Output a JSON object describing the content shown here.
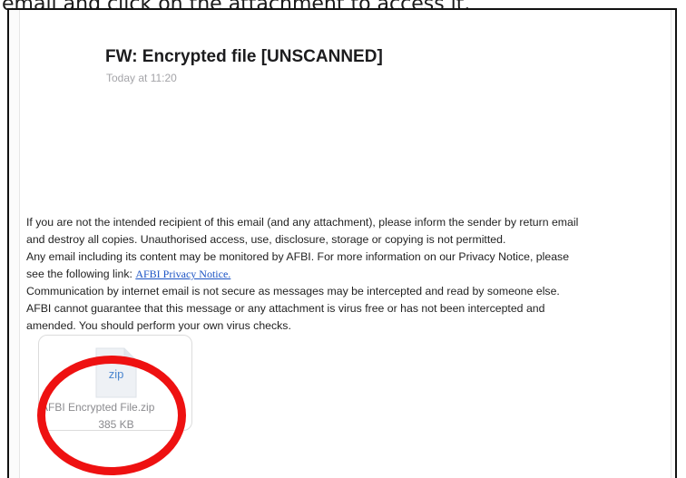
{
  "caption": {
    "text": "email and click on the attachment to access it."
  },
  "email": {
    "subject": "FW: Encrypted file [UNSCANNED]",
    "date": "Today at 11:20",
    "disclaimer": {
      "line1": "If you are not the intended recipient of this email (and any attachment), please inform the sender by return email",
      "line2": "and destroy all copies. Unauthorised access, use, disclosure, storage or copying is not permitted.",
      "line3": "Any email including its content may be monitored by AFBI. For more information on our Privacy Notice, please",
      "line4_prefix": "see the following link: ",
      "link_text": "AFBI Privacy Notice.",
      "line5": "Communication by internet email is not secure as messages may be intercepted and read by someone else.",
      "line6": "AFBI cannot guarantee that this message or any attachment is virus free or has not been intercepted and",
      "line7": "amended. You should perform your own virus checks."
    },
    "attachment": {
      "type_label": "zip",
      "name": "AFBI Encrypted File.zip",
      "size": "385 KB",
      "icon": "zip-file-icon"
    }
  },
  "annotation": {
    "shape": "circle",
    "color": "#ee1111"
  },
  "colors": {
    "link": "#1b53c4",
    "muted_text": "#a4a4a8",
    "zip_label": "#4a86cf"
  }
}
